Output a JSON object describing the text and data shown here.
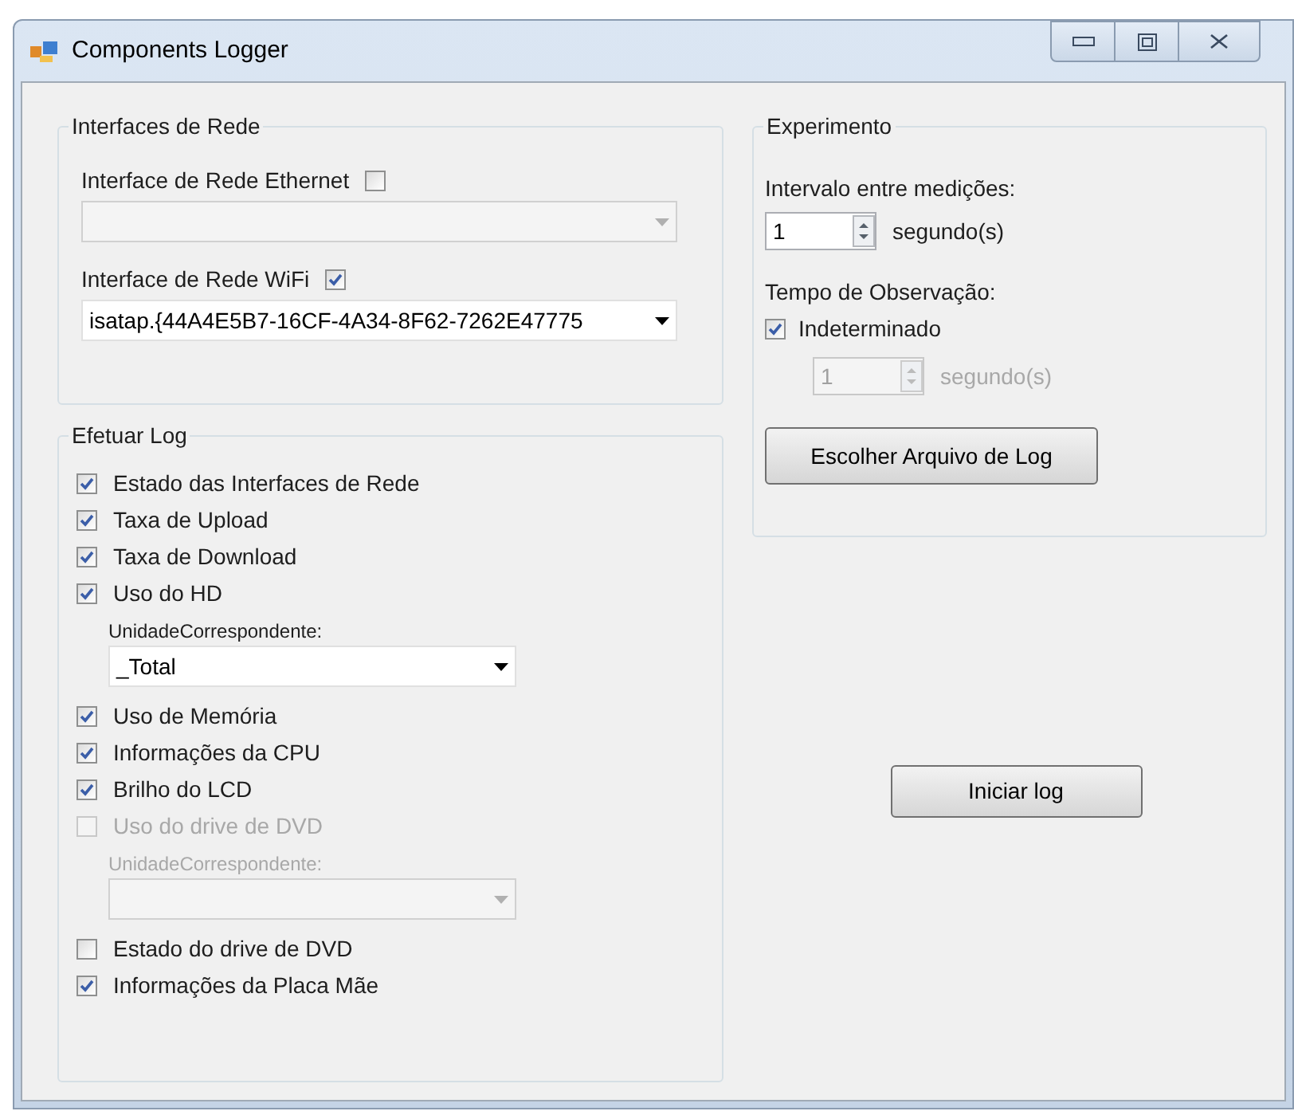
{
  "window": {
    "title": "Components Logger"
  },
  "network_group": {
    "title": "Interfaces de Rede",
    "interfaces": [
      {
        "label": "Interface de Rede Ethernet",
        "checked": false,
        "disabled": true
      },
      {
        "label": "Interface de Rede WiFi",
        "checked": true,
        "value": "isatap.{44A4E5B7-16CF-4A34-8F62-7262E47775",
        "disabled": false
      }
    ]
  },
  "log_group": {
    "title": "Efetuar Log",
    "items": [
      {
        "kind": "checkbox",
        "label": "Estado das Interfaces de Rede",
        "checked": true,
        "disabled": false
      },
      {
        "kind": "checkbox",
        "label": "Taxa de Upload",
        "checked": true,
        "disabled": false
      },
      {
        "kind": "checkbox",
        "label": "Taxa de Download",
        "checked": true,
        "disabled": false
      },
      {
        "kind": "checkbox",
        "label": "Uso do HD",
        "checked": true,
        "disabled": false
      },
      {
        "kind": "dropdown",
        "label": "UnidadeCorrespondente:",
        "value": "_Total",
        "disabled": false
      },
      {
        "kind": "checkbox",
        "label": "Uso de Memória",
        "checked": true,
        "disabled": false
      },
      {
        "kind": "checkbox",
        "label": "Informações da CPU",
        "checked": true,
        "disabled": false
      },
      {
        "kind": "checkbox",
        "label": "Brilho do LCD",
        "checked": true,
        "disabled": false
      },
      {
        "kind": "checkbox",
        "label": "Uso do drive de DVD",
        "checked": false,
        "disabled": true
      },
      {
        "kind": "dropdown",
        "label": "UnidadeCorrespondente:",
        "disabled": true
      },
      {
        "kind": "checkbox",
        "label": "Estado do drive de DVD",
        "checked": false,
        "disabled": false
      },
      {
        "kind": "checkbox",
        "label": "Informações da Placa Mãe",
        "checked": true,
        "disabled": false
      }
    ]
  },
  "experiment_group": {
    "title": "Experimento",
    "interval": {
      "label": "Intervalo entre medições:",
      "value": "1",
      "unit": "segundo(s)",
      "disabled": false
    },
    "observation": {
      "label": "Tempo de Observação:",
      "checkbox": {
        "label": "Indeterminado",
        "checked": true
      },
      "value": "1",
      "unit": "segundo(s)",
      "disabled": true
    },
    "choose_file_button": "Escolher Arquivo de Log"
  },
  "start_button": "Iniciar log"
}
